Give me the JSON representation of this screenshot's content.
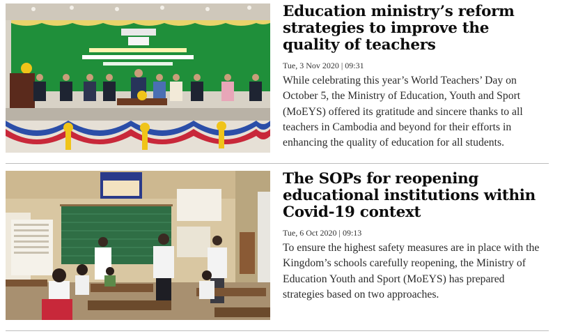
{
  "articles": [
    {
      "title": "Education ministry’s reform strategies to improve the quality of teachers",
      "date": "Tue, 3 Nov 2020 | 09:31",
      "summary": "While celebrating this year’s World Teachers’ Day on October 5, the Ministry of Education, Youth and Sport (MoEYS) offered its gratitude and sincere thanks to all teachers in Cambodia and beyond for their efforts in enhancing the quality of education for all students."
    },
    {
      "title": "The SOPs for reopening educational institutions within Covid-19 context",
      "date": "Tue, 6 Oct 2020 | 09:13",
      "summary": "To ensure the highest safety measures are in place with the Kingdom’s schools carefully reopening, the Ministry of Education Youth and Sport (MoEYS) has prepared strategies based on two approaches."
    }
  ],
  "colors": {
    "stage_green": "#1f8f3a",
    "drape_blue": "#2b4ea8",
    "drape_red": "#c8283a",
    "classroom_wall": "#d9c7a2",
    "chalkboard": "#2f6e45"
  },
  "icons": [
    "ceremony-photo",
    "classroom-photo"
  ]
}
